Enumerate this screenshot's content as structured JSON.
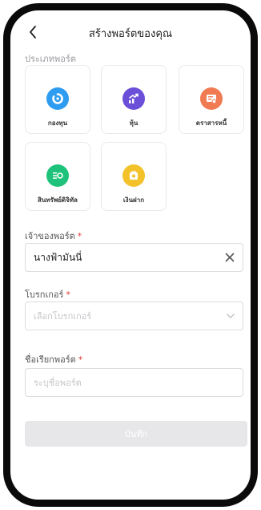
{
  "header": {
    "title": "สร้างพอร์ตของคุณ"
  },
  "portfolio_type": {
    "label": "ประเภทพอร์ต",
    "items": [
      {
        "label": "กองทุน",
        "icon": "fund-icon",
        "color": "#2e9cf0"
      },
      {
        "label": "หุ้น",
        "icon": "stock-chart-icon",
        "color": "#6b4fd8"
      },
      {
        "label": "ตราสารหนี้",
        "icon": "bond-icon",
        "color": "#f07a52"
      },
      {
        "label": "สินทรัพย์ดิจิทัล",
        "icon": "digital-asset-icon",
        "color": "#1fc27a"
      },
      {
        "label": "เงินฝาก",
        "icon": "deposit-icon",
        "color": "#f3c22b"
      }
    ]
  },
  "owner": {
    "label": "เจ้าของพอร์ต",
    "required_mark": "*",
    "value": "นางฟ้ามันนี่"
  },
  "broker": {
    "label": "โบรกเกอร์",
    "required_mark": "*",
    "placeholder": "เลือกโบรกเกอร์"
  },
  "port_name": {
    "label": "ชื่อเรียกพอร์ต",
    "required_mark": "*",
    "placeholder": "ระบุชื่อพอร์ต"
  },
  "save_label": "บันทึก"
}
